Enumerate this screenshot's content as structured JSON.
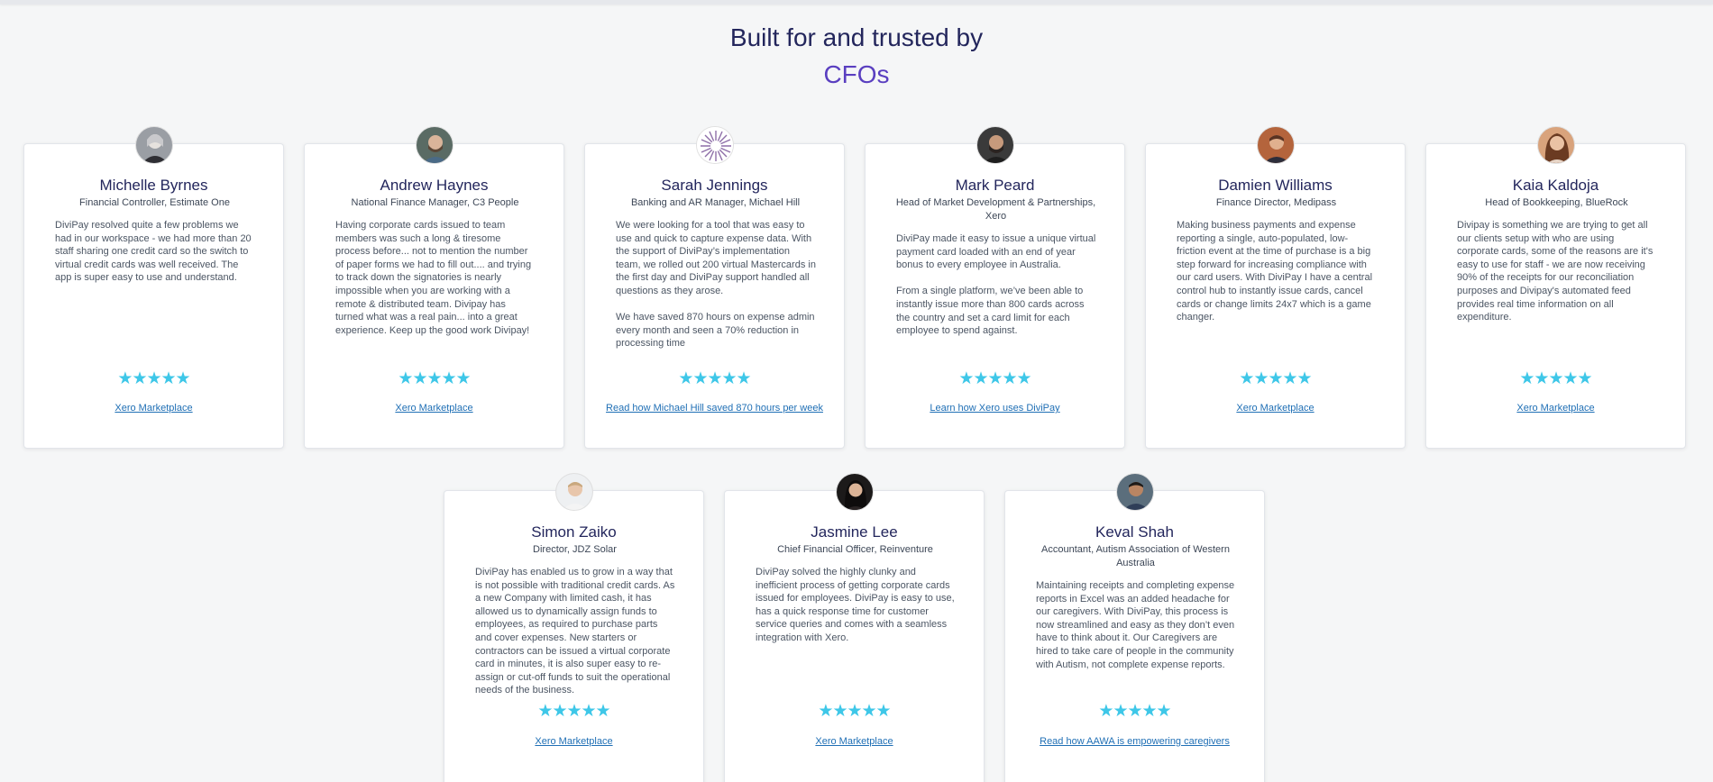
{
  "heading": {
    "line1": "Built for and trusted by",
    "line2": "CFOs"
  },
  "colors": {
    "title": "#23265c",
    "accent": "#5a3fc0",
    "star": "#3ec7e8",
    "link": "#1f6fb5"
  },
  "stars_icon": "star-icon",
  "testimonials": [
    {
      "name": "Michelle Byrnes",
      "role": "Financial Controller, Estimate One",
      "quote": "DiviPay resolved quite a few problems we had in our workspace - we had more than 20 staff sharing one credit card so the switch to virtual credit cards was well received. The app is super easy to use and understand.",
      "rating": 5,
      "stars": "★★★★★",
      "link": "Xero Marketplace"
    },
    {
      "name": "Andrew Haynes",
      "role": "National Finance Manager, C3 People",
      "quote": "Having corporate cards issued to team members was such a long & tiresome process before... not to mention the number of paper forms we had to fill out.... and trying to track down the signatories is nearly impossible when you are working with a remote & distributed team. Divipay has turned what was a real pain... into a great experience. Keep up the good work Divipay!",
      "rating": 5,
      "stars": "★★★★★",
      "link": "Xero Marketplace"
    },
    {
      "name": "Sarah Jennings",
      "role": "Banking and AR Manager, Michael Hill",
      "quote": "We were looking for a tool that was easy to use and quick to capture expense data. With the support of DiviPay’s implementation team, we rolled out 200 virtual Mastercards in the first day and DiviPay support handled all questions as they arose.\n\nWe have saved 870 hours on expense admin every month and seen a 70% reduction in processing time",
      "rating": 5,
      "stars": "★★★★★",
      "link": "Read how Michael Hill saved 870 hours per week"
    },
    {
      "name": "Mark Peard",
      "role": "Head of Market Development & Partnerships, Xero",
      "quote": "DiviPay made it easy to issue a unique virtual payment card loaded with an end of year bonus to every employee in Australia.\n\nFrom a single platform, we’ve been able to instantly issue more than 800 cards across the country and set a card limit for each employee to spend against.",
      "rating": 5,
      "stars": "★★★★★",
      "link": "Learn how Xero uses DiviPay"
    },
    {
      "name": "Damien Williams",
      "role": "Finance Director, Medipass",
      "quote": "Making business payments and expense reporting a single, auto-populated, low-friction event at the time of purchase is a big step forward for increasing compliance with our card users. With DiviPay I have a central control hub to instantly issue cards, cancel cards or change limits 24x7 which is a game changer.",
      "rating": 5,
      "stars": "★★★★★",
      "link": "Xero Marketplace"
    },
    {
      "name": "Kaia Kaldoja",
      "role": "Head of Bookkeeping, BlueRock",
      "quote": "Divipay is something we are trying to get all our clients setup with who are using corporate cards, some of the reasons are it's easy to use for staff - we are now receiving 90% of the receipts for our reconciliation purposes and Divipay's automated feed provides real time information on all expenditure.",
      "rating": 5,
      "stars": "★★★★★",
      "link": "Xero Marketplace"
    },
    {
      "name": "Simon Zaiko",
      "role": "Director, JDZ Solar",
      "quote": "DiviPay has enabled us to grow in a way that is not possible with traditional credit cards. As a new Company with limited cash, it has allowed us to dynamically assign funds to employees, as required to purchase parts and cover expenses. New starters or contractors can be issued a virtual corporate card in minutes, it is also super easy to re-assign or cut-off funds to suit the operational needs of the business.",
      "rating": 5,
      "stars": "★★★★★",
      "link": "Xero Marketplace"
    },
    {
      "name": "Jasmine Lee",
      "role": "Chief Financial Officer, Reinventure",
      "quote": "DiviPay solved the highly clunky and inefficient process of getting corporate cards issued for employees. DiviPay is easy to use, has a quick response time for customer service queries and comes with a seamless integration with Xero.",
      "rating": 5,
      "stars": "★★★★★",
      "link": "Xero Marketplace"
    },
    {
      "name": "Keval Shah",
      "role": "Accountant, Autism Association of Western Australia",
      "quote": "Maintaining receipts and completing expense reports in Excel was an added headache for our caregivers. With DiviPay, this process is now streamlined and easy as they don’t even have to think about it. Our Caregivers are hired to take care of people in the community with Autism, not complete expense reports.",
      "rating": 5,
      "stars": "★★★★★",
      "link": "Read how AAWA is empowering caregivers"
    }
  ]
}
